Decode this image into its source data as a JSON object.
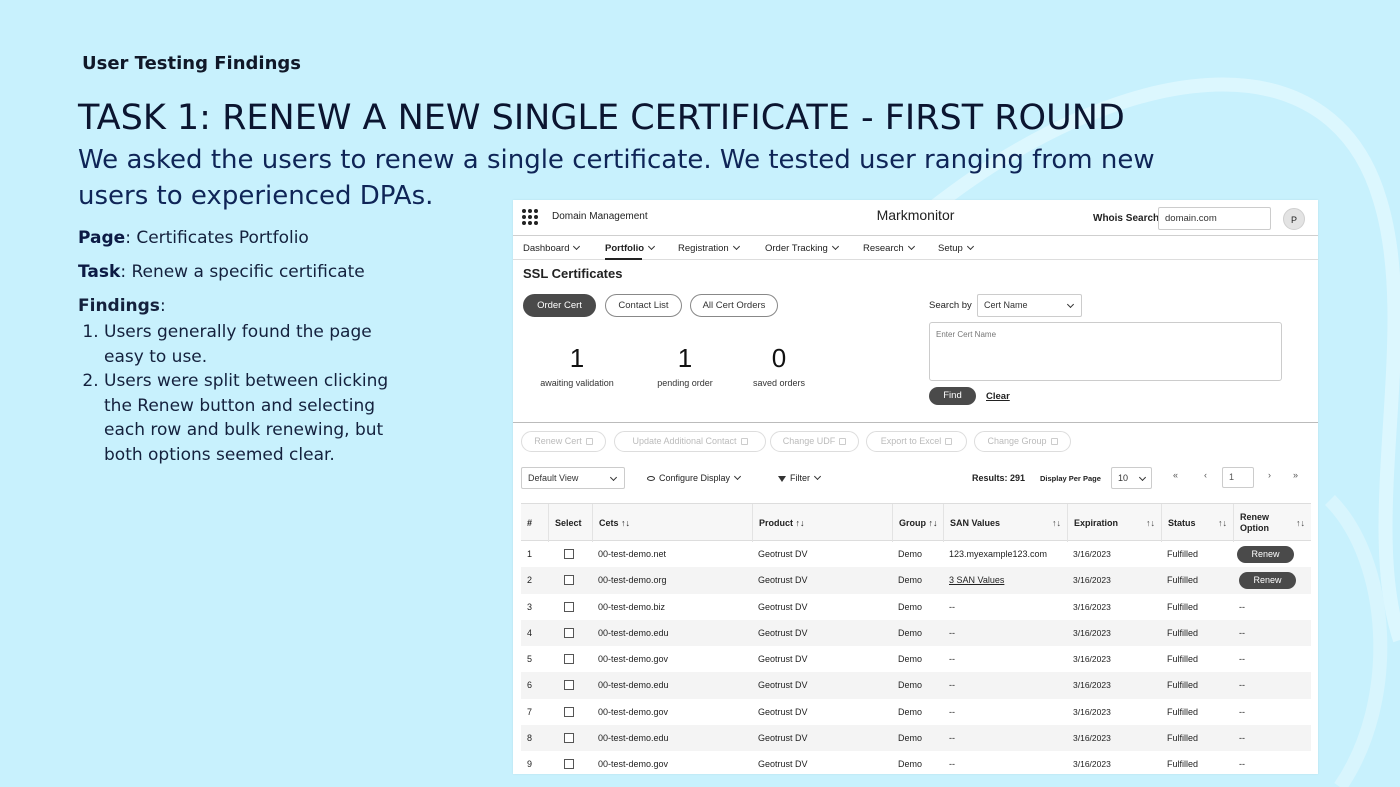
{
  "slide": {
    "section_label": "User Testing Findings",
    "title": "TASK 1: RENEW A NEW SINGLE CERTIFICATE - FIRST ROUND",
    "description": "We asked the users to renew a single certificate. We tested user ranging from new users to experienced DPAs.",
    "page_label": "Page",
    "page_value": ": Certificates Portfolio",
    "task_label": "Task",
    "task_value": ": Renew a specific certificate",
    "findings_label": "Findings",
    "findings_colon": ":",
    "findings": [
      "Users generally found the page easy to use.",
      "Users were split between clicking the Renew button and selecting each row and bulk renewing, but both options seemed clear."
    ]
  },
  "app": {
    "module": "Domain Management",
    "brand": "Markmonitor",
    "whois_label": "Whois Search",
    "whois_value": "domain.com",
    "avatar": "P",
    "nav": [
      "Dashboard",
      "Portfolio",
      "Registration",
      "Order Tracking",
      "Research",
      "Setup"
    ],
    "page_title": "SSL Certificates",
    "pills": [
      "Order Cert",
      "Contact List",
      "All Cert Orders"
    ],
    "stats": [
      {
        "num": "1",
        "label": "awaiting validation"
      },
      {
        "num": "1",
        "label": "pending order"
      },
      {
        "num": "0",
        "label": "saved orders"
      }
    ],
    "search_by_label": "Search by",
    "search_by_value": "Cert Name",
    "cert_placeholder": "Enter Cert Name",
    "find": "Find",
    "clear": "Clear",
    "actions": [
      "Renew Cert",
      "Update Additional Contact",
      "Change UDF",
      "Export to Excel",
      "Change Group"
    ],
    "view_select": "Default View",
    "configure_display": "Configure Display",
    "filter": "Filter",
    "results": "Results: 291",
    "display_per_page_label": "Display Per Page",
    "per_page": "10",
    "pager": {
      "first": "«",
      "prev": "‹",
      "page": "1",
      "next": "›",
      "last": "»"
    },
    "columns": [
      "#",
      "Select",
      "Cets",
      "Product",
      "Group",
      "SAN Values",
      "Expiration",
      "Status",
      "Renew Option"
    ],
    "sort_icon": "↑↓",
    "rows": [
      {
        "n": "1",
        "cert": "00-test-demo.net",
        "product": "Geotrust DV",
        "group": "Demo",
        "san": "123.myexample123.com",
        "exp": "3/16/2023",
        "status": "Fulfilled",
        "renew": "Renew"
      },
      {
        "n": "2",
        "cert": "00-test-demo.org",
        "product": "Geotrust DV",
        "group": "Demo",
        "san": "3 SAN Values",
        "exp": "3/16/2023",
        "status": "Fulfilled",
        "renew": "Renew"
      },
      {
        "n": "3",
        "cert": "00-test-demo.biz",
        "product": "Geotrust DV",
        "group": "Demo",
        "san": "--",
        "exp": "3/16/2023",
        "status": "Fulfilled",
        "renew": "--"
      },
      {
        "n": "4",
        "cert": "00-test-demo.edu",
        "product": "Geotrust DV",
        "group": "Demo",
        "san": "--",
        "exp": "3/16/2023",
        "status": "Fulfilled",
        "renew": "--"
      },
      {
        "n": "5",
        "cert": "00-test-demo.gov",
        "product": "Geotrust DV",
        "group": "Demo",
        "san": "--",
        "exp": "3/16/2023",
        "status": "Fulfilled",
        "renew": "--"
      },
      {
        "n": "6",
        "cert": "00-test-demo.edu",
        "product": "Geotrust DV",
        "group": "Demo",
        "san": "--",
        "exp": "3/16/2023",
        "status": "Fulfilled",
        "renew": "--"
      },
      {
        "n": "7",
        "cert": "00-test-demo.gov",
        "product": "Geotrust DV",
        "group": "Demo",
        "san": "--",
        "exp": "3/16/2023",
        "status": "Fulfilled",
        "renew": "--"
      },
      {
        "n": "8",
        "cert": "00-test-demo.edu",
        "product": "Geotrust DV",
        "group": "Demo",
        "san": "--",
        "exp": "3/16/2023",
        "status": "Fulfilled",
        "renew": "--"
      },
      {
        "n": "9",
        "cert": "00-test-demo.gov",
        "product": "Geotrust DV",
        "group": "Demo",
        "san": "--",
        "exp": "3/16/2023",
        "status": "Fulfilled",
        "renew": "--"
      }
    ]
  }
}
